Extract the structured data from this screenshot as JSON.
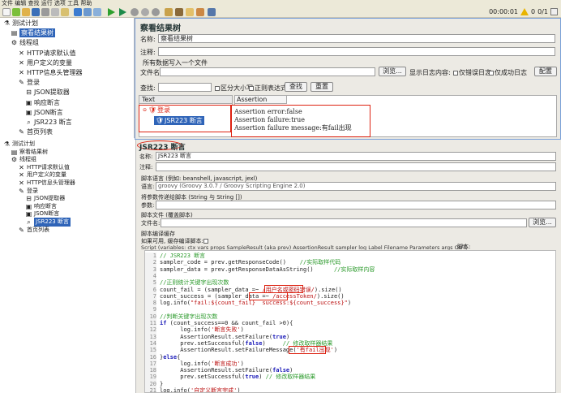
{
  "menubar": {
    "text": "文件 编辑 查找 运行 选项 工具 帮助"
  },
  "toolbar": {
    "timer": "00:00:01",
    "warn_count": "0",
    "threads": "0/1"
  },
  "top_tree": [
    {
      "label": "测试计划",
      "icon": "flask-icon",
      "depth": 0
    },
    {
      "label": "察看结果树",
      "icon": "chart-icon",
      "depth": 1,
      "selected": true
    },
    {
      "label": "线程组",
      "icon": "gear-icon",
      "depth": 1
    },
    {
      "label": "HTTP请求默认值",
      "icon": "wrench-icon",
      "depth": 2
    },
    {
      "label": "用户定义的变量",
      "icon": "wrench-icon",
      "depth": 2
    },
    {
      "label": "HTTP信息头管理器",
      "icon": "wrench-icon",
      "depth": 2
    },
    {
      "label": "登录",
      "icon": "pencil-icon",
      "depth": 2
    },
    {
      "label": "JSON提取器",
      "icon": "extract-icon",
      "depth": 3
    },
    {
      "label": "响应断言",
      "icon": "assert-icon",
      "depth": 3
    },
    {
      "label": "JSON断言",
      "icon": "assert-icon",
      "depth": 3
    },
    {
      "label": "JSR223 断言",
      "icon": "search-icon",
      "depth": 3
    },
    {
      "label": "首页列表",
      "icon": "pencil-icon",
      "depth": 2
    }
  ],
  "result_tree": {
    "title": "察看结果树",
    "name_label": "名称:",
    "name_value": "察看结果树",
    "comment_label": "注释:",
    "file_section": "所有数据写入一个文件",
    "filename_label": "文件名",
    "browse": "浏览...",
    "show_log": "显示日志内容:",
    "only_errors": "仅错误日志",
    "only_success": "仅成功日志",
    "config": "配置",
    "search_label": "查找:",
    "case": "区分大小写",
    "regex": "正则表达式",
    "find_btn": "查找",
    "reset_btn": "重置",
    "col_text": "Text",
    "tab_assertion": "Assertion result",
    "sample": "登录",
    "sample_child": "JSR223 断言",
    "assertion_lines": [
      "Assertion error:false",
      "Assertion failure:true",
      "Assertion failure message:有fail出现"
    ]
  },
  "bottom_tree": [
    {
      "label": "测试计划",
      "icon": "flask-icon",
      "depth": 0
    },
    {
      "label": "察看结果树",
      "icon": "chart-icon",
      "depth": 1
    },
    {
      "label": "线程组",
      "icon": "gear-icon",
      "depth": 1
    },
    {
      "label": "HTTP请求默认值",
      "icon": "wrench-icon",
      "depth": 2
    },
    {
      "label": "用户定义的变量",
      "icon": "wrench-icon",
      "depth": 2
    },
    {
      "label": "HTTP信息头管理器",
      "icon": "wrench-icon",
      "depth": 2
    },
    {
      "label": "登录",
      "icon": "pencil-icon",
      "depth": 2
    },
    {
      "label": "JSON提取器",
      "icon": "extract-icon",
      "depth": 3
    },
    {
      "label": "响应断言",
      "icon": "assert-icon",
      "depth": 3
    },
    {
      "label": "JSON断言",
      "icon": "assert-icon",
      "depth": 3
    },
    {
      "label": "JSR223 断言",
      "icon": "search-icon",
      "depth": 3,
      "selected": true
    },
    {
      "label": "首页列表",
      "icon": "pencil-icon",
      "depth": 2
    }
  ],
  "jsr": {
    "title": "JSR223 断言",
    "name_label": "名称:",
    "name_value": "JSR223 断言",
    "comment_label": "注释:",
    "lang_section": "脚本语言 (例如: beanshell, javascript, jexl)",
    "lang_label": "语言:",
    "lang_value": "groovy      (Groovy 3.0.7 / Groovy Scripting Engine 2.0)",
    "params_section": "将参数传递给脚本 (String 与 String [])",
    "params_label": "参数:",
    "file_section": "脚本文件 (覆盖脚本)",
    "file_label": "文件名:",
    "browse": "浏览...",
    "cache_section": "脚本编译缓存",
    "cache_label": "如果可用, 缓存编译脚本:",
    "script_hint": "Script (variables: ctx vars props SampleResult (aka prev) AssertionResult sampler log Label Filename Parameters args OUT)",
    "script_label": "脚本:"
  },
  "code_lines": [
    [
      [
        "cm",
        "// JSR223 断言"
      ]
    ],
    [
      [
        "",
        "sampler_code = prev.getResponseCode()    "
      ],
      [
        "cm",
        "//实际取样代码"
      ]
    ],
    [
      [
        "",
        "sampler_data = prev.getResponseDataAsString()      "
      ],
      [
        "cm",
        "//实际取样内容"
      ]
    ],
    [
      [
        "",
        ""
      ]
    ],
    [
      [
        "cm",
        "//正则统计关键字出现次数"
      ]
    ],
    [
      [
        "",
        "count_fail = (sampler_data =~ "
      ],
      [
        "st",
        "/用户名或密码错误/"
      ],
      [
        "",
        ").size()"
      ]
    ],
    [
      [
        "",
        "count_success = (sampler_data =~ "
      ],
      [
        "st",
        "/accessToken/"
      ],
      [
        "",
        ").size()"
      ]
    ],
    [
      [
        "",
        "log.info("
      ],
      [
        "st",
        "\"fail:${count_fail}  success:${count_success}\""
      ],
      [
        "",
        ")"
      ]
    ],
    [
      [
        "",
        ""
      ]
    ],
    [
      [
        "cm",
        "//判断关键字出现次数"
      ]
    ],
    [
      [
        "kw",
        "if"
      ],
      [
        "",
        " (count_success==0 && count_fail >0){"
      ]
    ],
    [
      [
        "",
        "      log.info("
      ],
      [
        "st",
        "'断言失败'"
      ],
      [
        "",
        ")"
      ]
    ],
    [
      [
        "",
        "      AssertionResult.setFailure("
      ],
      [
        "kw",
        "true"
      ],
      [
        "",
        ")"
      ]
    ],
    [
      [
        "",
        "      prev.setSuccessful("
      ],
      [
        "kw",
        "false"
      ],
      [
        "",
        ")     "
      ],
      [
        "cm",
        "// 修改取样器结果"
      ]
    ],
    [
      [
        "",
        "      AssertionResult.setFailureMessage("
      ],
      [
        "st",
        "'有fail出现'"
      ],
      [
        "",
        ")"
      ]
    ],
    [
      [
        "",
        "}"
      ],
      [
        "kw",
        "else"
      ],
      [
        "",
        "{"
      ]
    ],
    [
      [
        "",
        "      log.info("
      ],
      [
        "st",
        "'断言成功'"
      ],
      [
        "",
        ")"
      ]
    ],
    [
      [
        "",
        "      AssertionResult.setFailure("
      ],
      [
        "kw",
        "false"
      ],
      [
        "",
        ")"
      ]
    ],
    [
      [
        "",
        "      prev.setSuccessful("
      ],
      [
        "kw",
        "true"
      ],
      [
        "",
        ") "
      ],
      [
        "cm",
        "// 修改取样器结果"
      ]
    ],
    [
      [
        "",
        "}"
      ]
    ],
    [
      [
        "",
        "log.info("
      ],
      [
        "st",
        "'自定义断言完成'"
      ],
      [
        "",
        ")"
      ]
    ]
  ]
}
